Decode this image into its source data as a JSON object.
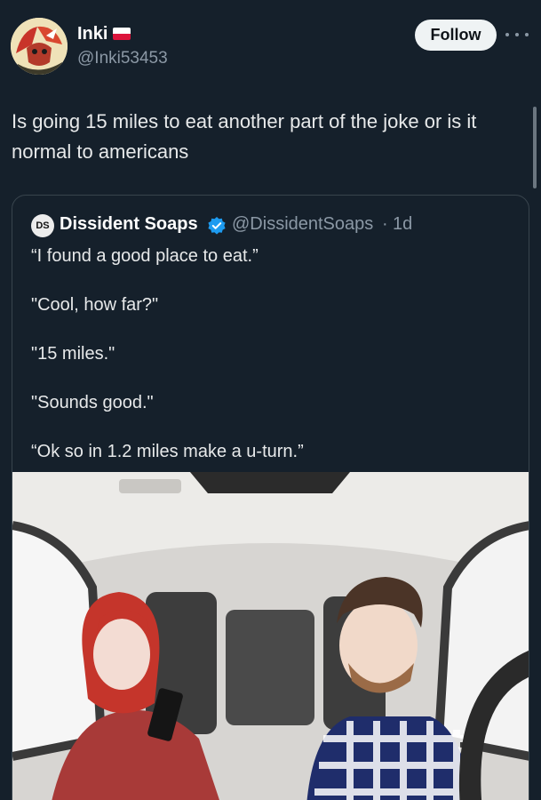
{
  "author": {
    "display_name": "Inki",
    "handle": "@Inki53453",
    "avatar_icon": "cartoon-avatar-icon",
    "flag_icon": "poland-flag-icon"
  },
  "header": {
    "follow_label": "Follow",
    "more_icon": "more-options-icon"
  },
  "tweet": {
    "text": "Is going 15 miles to eat another part of the joke or is it normal to americans"
  },
  "quote": {
    "avatar_text": "DS",
    "display_name": "Dissident Soaps",
    "verified_icon": "verified-badge-icon",
    "handle": "@DissidentSoaps",
    "separator": "·",
    "time": "1d",
    "lines": [
      "“I found a good place to eat.”",
      "\"Cool, how far?\"",
      "\"15 miles.\"",
      "\"Sounds good.\"",
      "“Ok so in 1.2 miles make a u-turn.”"
    ],
    "image_icon": "car-interior-cartoon-image"
  },
  "colors": {
    "background": "#15202b",
    "text": "#e7e9ea",
    "muted": "#8b98a5",
    "border": "#38444d",
    "verified": "#1d9bf0"
  }
}
